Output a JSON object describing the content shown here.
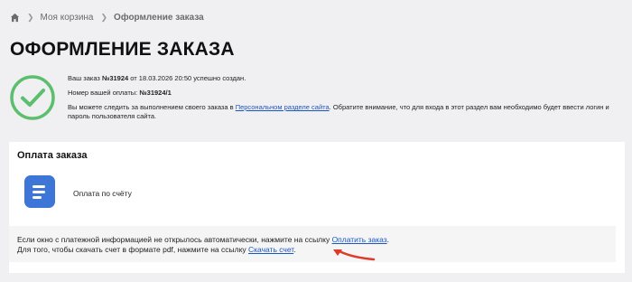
{
  "breadcrumb": {
    "home_icon": "home-icon",
    "cart": "Моя корзина",
    "current": "Оформление заказа"
  },
  "page": {
    "title": "ОФОРМЛЕНИЕ ЗАКАЗА"
  },
  "order": {
    "line1_prefix": "Ваш заказ ",
    "order_number": "№31924",
    "line1_suffix": " от 18.03.2026 20:50 успешно создан.",
    "line2_prefix": "Номер вашей оплаты: ",
    "payment_number": "№31924/1",
    "line3_prefix": "Вы можете следить за выполнением своего заказа в ",
    "line3_link": "Персональном разделе сайта",
    "line3_suffix": ". Обратите внимание, что для входа в этот раздел вам необходимо будет ввести логин и пароль пользователя сайта.",
    "status_icon": "check-circle-icon",
    "status_color": "#5cbf6e"
  },
  "payment": {
    "title": "Оплата заказа",
    "method_icon": "invoice-icon",
    "method_label": "Оплата по счёту",
    "accent": "#3d76d6",
    "note_line1_prefix": "Если окно с платежной информацией не открылось автоматически, нажмите на ссылку ",
    "note_line1_link": "Оплатить заказ",
    "note_line1_suffix": ".",
    "note_line2_prefix": "Для того, чтобы скачать счет в формате pdf, нажмите на ссылку ",
    "note_line2_link": "Скачать счет",
    "note_line2_suffix": ".",
    "arrow_color": "#e0382b"
  }
}
